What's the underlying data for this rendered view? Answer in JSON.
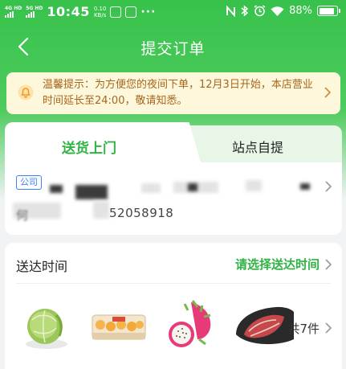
{
  "status_bar": {
    "network1": "4G HD",
    "network2": "5G HD",
    "time": "10:45",
    "speed_value": "0.10",
    "speed_unit": "KB/s",
    "more": "···",
    "battery": "88%",
    "battery_level": 0.88
  },
  "header": {
    "title": "提交订单"
  },
  "notice": {
    "text": "温馨提示：为方便您的夜间下单，12月3日开始，本店营业时间延长至24:00，敬请知悉。"
  },
  "delivery": {
    "tabs": [
      {
        "label": "送货上门",
        "active": true
      },
      {
        "label": "站点自提",
        "active": false
      }
    ],
    "address_tag": "公司",
    "name_partial": "何",
    "phone_partial": "52058918"
  },
  "delivery_time": {
    "label": "送达时间",
    "choose": "请选择送达时间",
    "products": [
      "cabbage",
      "egg-tart-box",
      "dragon-fruit",
      "sliced-meat"
    ],
    "total": "共7件"
  },
  "colors": {
    "brand_green": "#2fb344",
    "header_green": "#37c24b",
    "notice_bg": "#fdf7dc",
    "notice_text": "#a8661d",
    "tag_blue": "#3b82f6"
  }
}
